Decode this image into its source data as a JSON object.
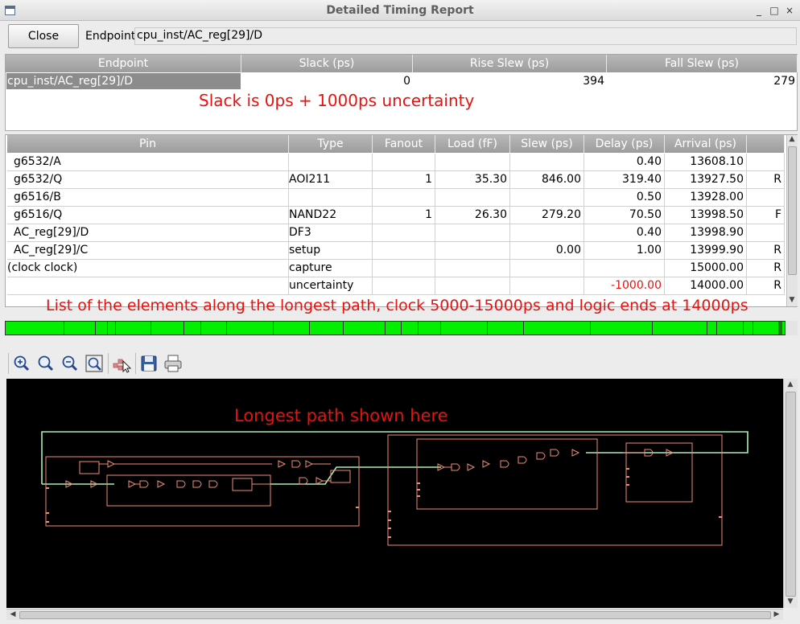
{
  "window": {
    "title": "Detailed Timing Report",
    "controls": {
      "minimize": "_",
      "maximize": "□",
      "close": "×"
    }
  },
  "toolbar": {
    "close_label": "Close",
    "endpoint_label": "Endpoint:",
    "endpoint_value": "cpu_inst/AC_reg[29]/D"
  },
  "summary": {
    "headers": [
      "Endpoint",
      "Slack (ps)",
      "Rise Slew (ps)",
      "Fall Slew (ps)"
    ],
    "row": {
      "endpoint": "cpu_inst/AC_reg[29]/D",
      "slack": "0",
      "rise_slew": "394",
      "fall_slew": "279"
    },
    "annotation": "Slack is 0ps + 1000ps uncertainty"
  },
  "path": {
    "headers": [
      "Pin",
      "Type",
      "Fanout",
      "Load (fF)",
      "Slew (ps)",
      "Delay (ps)",
      "Arrival (ps)",
      ""
    ],
    "rows": [
      {
        "pin": "g6532/A",
        "type": "",
        "fanout": "",
        "load": "",
        "slew": "",
        "delay": "0.40",
        "arrival": "13608.10",
        "edge": ""
      },
      {
        "pin": "g6532/Q",
        "type": "AOI211",
        "fanout": "1",
        "load": "35.30",
        "slew": "846.00",
        "delay": "319.40",
        "arrival": "13927.50",
        "edge": "R"
      },
      {
        "pin": "g6516/B",
        "type": "",
        "fanout": "",
        "load": "",
        "slew": "",
        "delay": "0.50",
        "arrival": "13928.00",
        "edge": ""
      },
      {
        "pin": "g6516/Q",
        "type": "NAND22",
        "fanout": "1",
        "load": "26.30",
        "slew": "279.20",
        "delay": "70.50",
        "arrival": "13998.50",
        "edge": "F"
      },
      {
        "pin": "AC_reg[29]/D",
        "type": "DF3",
        "fanout": "",
        "load": "",
        "slew": "",
        "delay": "0.40",
        "arrival": "13998.90",
        "edge": ""
      },
      {
        "pin": "AC_reg[29]/C",
        "type": "setup",
        "fanout": "",
        "load": "",
        "slew": "0.00",
        "delay": "1.00",
        "arrival": "13999.90",
        "edge": "R"
      },
      {
        "pin": "(clock clock)",
        "type": "capture",
        "fanout": "",
        "load": "",
        "slew": "",
        "delay": "",
        "arrival": "15000.00",
        "edge": "R"
      },
      {
        "pin": "",
        "type": "uncertainty",
        "fanout": "",
        "load": "",
        "slew": "",
        "delay": "-1000.00",
        "arrival": "14000.00",
        "edge": "R"
      }
    ],
    "annotation": "List of the elements along the longest path, clock 5000-15000ps and logic ends at 14000ps"
  },
  "timing_bar": {
    "color": "#00f000"
  },
  "schematic_toolbar": {
    "icons": [
      "zoom-in-icon",
      "zoom-normal-icon",
      "zoom-out-icon",
      "zoom-fit-icon",
      "select-tool-icon",
      "save-icon",
      "print-icon"
    ]
  },
  "schematic": {
    "annotation": "Longest path shown here",
    "colors": {
      "background": "#000000",
      "cell": "#f08c78",
      "path": "#a8f0b8"
    }
  }
}
